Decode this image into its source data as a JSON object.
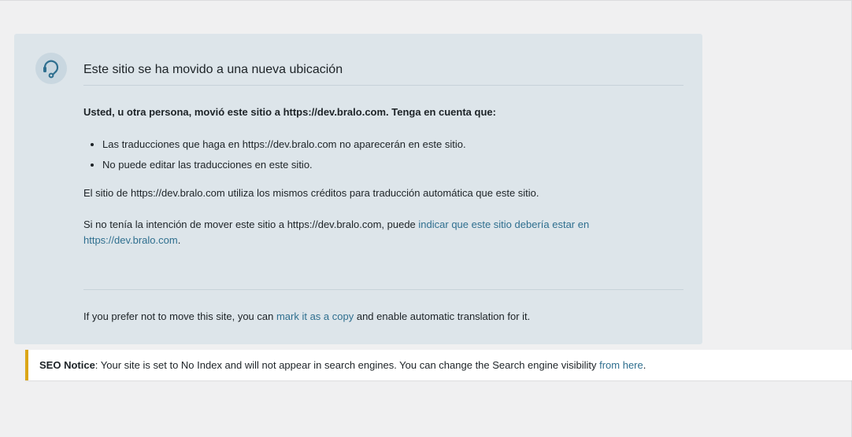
{
  "panel": {
    "title": "Este sitio se ha movido a una nueva ubicación",
    "lead": "Usted, u otra persona, movió este sitio a https://dev.bralo.com. Tenga en cuenta que:",
    "bullets": [
      "Las traducciones que haga en https://dev.bralo.com no aparecerán en este sitio.",
      "No puede editar las traducciones en este sitio."
    ],
    "credits_text": "El sitio de https://dev.bralo.com utiliza los mismos créditos para traducción automática que este sitio.",
    "move_text_before": "Si no tenía la intención de mover este sitio a https://dev.bralo.com, puede ",
    "move_link": "indicar que este sitio debería estar en https://dev.bralo.com",
    "move_text_after": ".",
    "footer_before": "If you prefer not to move this site, you can ",
    "footer_link": "mark it as a copy",
    "footer_after": " and enable automatic translation for it."
  },
  "seo_notice": {
    "label": "SEO Notice",
    "text": ": Your site is set to No Index and will not appear in search engines. You can change the Search engine visibility ",
    "link": "from here",
    "after": "."
  },
  "colors": {
    "panel_bg": "#dde5ea",
    "link": "#2f6f8f",
    "notice_border": "#dba617",
    "icon": "#2f6f8f"
  },
  "icons": {
    "panel": "support-headset-icon"
  }
}
